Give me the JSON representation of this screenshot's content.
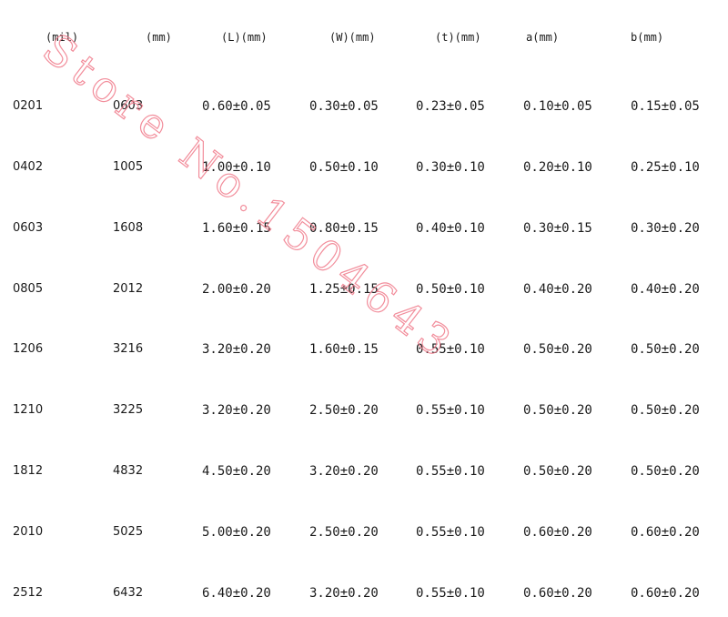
{
  "table": {
    "headers": [
      "(mil)",
      "(mm)",
      "(L)(mm)",
      "(W)(mm)",
      "(t)(mm)",
      "a(mm)",
      "b(mm)"
    ],
    "rows": [
      [
        "0201",
        "0603",
        "0.60±0.05",
        "0.30±0.05",
        "0.23±0.05",
        "0.10±0.05",
        "0.15±0.05"
      ],
      [
        "0402",
        "1005",
        "1.00±0.10",
        "0.50±0.10",
        "0.30±0.10",
        "0.20±0.10",
        "0.25±0.10"
      ],
      [
        "0603",
        "1608",
        "1.60±0.15",
        "0.80±0.15",
        "0.40±0.10",
        "0.30±0.15",
        "0.30±0.20"
      ],
      [
        "0805",
        "2012",
        "2.00±0.20",
        "1.25±0.15",
        "0.50±0.10",
        "0.40±0.20",
        "0.40±0.20"
      ],
      [
        "1206",
        "3216",
        "3.20±0.20",
        "1.60±0.15",
        "0.55±0.10",
        "0.50±0.20",
        "0.50±0.20"
      ],
      [
        "1210",
        "3225",
        "3.20±0.20",
        "2.50±0.20",
        "0.55±0.10",
        "0.50±0.20",
        "0.50±0.20"
      ],
      [
        "1812",
        "4832",
        "4.50±0.20",
        "3.20±0.20",
        "0.55±0.10",
        "0.50±0.20",
        "0.50±0.20"
      ],
      [
        "2010",
        "5025",
        "5.00±0.20",
        "2.50±0.20",
        "0.55±0.10",
        "0.60±0.20",
        "0.60±0.20"
      ],
      [
        "2512",
        "6432",
        "6.40±0.20",
        "3.20±0.20",
        "0.55±0.10",
        "0.60±0.20",
        "0.60±0.20"
      ]
    ]
  },
  "watermark": {
    "text": "Store No.1504643",
    "color": "#f07a8a"
  }
}
